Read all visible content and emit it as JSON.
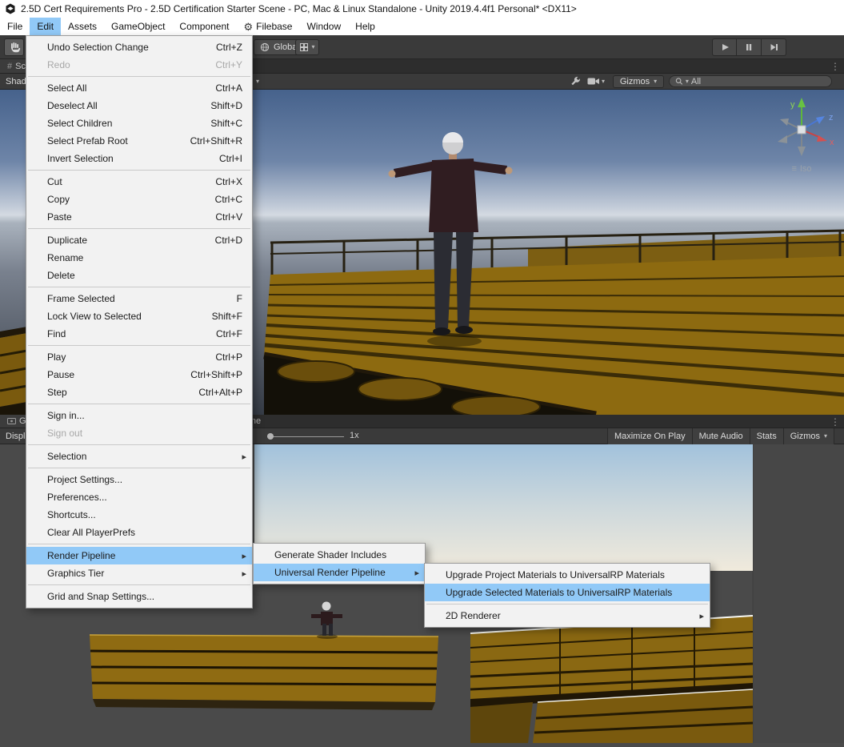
{
  "titlebar": {
    "title": "2.5D Cert Requirements Pro - 2.5D Certification Starter Scene - PC, Mac & Linux Standalone - Unity 2019.4.4f1 Personal* <DX11>"
  },
  "menubar": {
    "items": [
      {
        "label": "File"
      },
      {
        "label": "Edit",
        "selected": true
      },
      {
        "label": "Assets"
      },
      {
        "label": "GameObject"
      },
      {
        "label": "Component"
      },
      {
        "label": "Filebase",
        "icon": "gear"
      },
      {
        "label": "Window"
      },
      {
        "label": "Help"
      }
    ]
  },
  "toolbar": {
    "global_label": "Global"
  },
  "scene_panel": {
    "tab_label": "Scene",
    "shading_label": "Shaded",
    "gizmos_label": "Gizmos",
    "search_value": "All",
    "gizmo": {
      "x": "x",
      "y": "y",
      "z": "z",
      "projection": "Iso"
    }
  },
  "game_panel": {
    "tab_label": "Game",
    "timeline_tab_label": "Timeline",
    "display_label": "Display 1",
    "scale_label": "1x",
    "maximize_label": "Maximize On Play",
    "mute_label": "Mute Audio",
    "stats_label": "Stats",
    "gizmos_label": "Gizmos"
  },
  "edit_menu": {
    "items": [
      {
        "label": "Undo Selection Change",
        "shortcut": "Ctrl+Z"
      },
      {
        "label": "Redo",
        "shortcut": "Ctrl+Y",
        "disabled": true
      },
      {
        "sep": true
      },
      {
        "label": "Select All",
        "shortcut": "Ctrl+A"
      },
      {
        "label": "Deselect All",
        "shortcut": "Shift+D"
      },
      {
        "label": "Select Children",
        "shortcut": "Shift+C"
      },
      {
        "label": "Select Prefab Root",
        "shortcut": "Ctrl+Shift+R"
      },
      {
        "label": "Invert Selection",
        "shortcut": "Ctrl+I"
      },
      {
        "sep": true
      },
      {
        "label": "Cut",
        "shortcut": "Ctrl+X"
      },
      {
        "label": "Copy",
        "shortcut": "Ctrl+C"
      },
      {
        "label": "Paste",
        "shortcut": "Ctrl+V"
      },
      {
        "sep": true
      },
      {
        "label": "Duplicate",
        "shortcut": "Ctrl+D"
      },
      {
        "label": "Rename"
      },
      {
        "label": "Delete"
      },
      {
        "sep": true
      },
      {
        "label": "Frame Selected",
        "shortcut": "F"
      },
      {
        "label": "Lock View to Selected",
        "shortcut": "Shift+F"
      },
      {
        "label": "Find",
        "shortcut": "Ctrl+F"
      },
      {
        "sep": true
      },
      {
        "label": "Play",
        "shortcut": "Ctrl+P"
      },
      {
        "label": "Pause",
        "shortcut": "Ctrl+Shift+P"
      },
      {
        "label": "Step",
        "shortcut": "Ctrl+Alt+P"
      },
      {
        "sep": true
      },
      {
        "label": "Sign in..."
      },
      {
        "label": "Sign out",
        "disabled": true
      },
      {
        "sep": true
      },
      {
        "label": "Selection",
        "submenu": true
      },
      {
        "sep": true
      },
      {
        "label": "Project Settings..."
      },
      {
        "label": "Preferences..."
      },
      {
        "label": "Shortcuts..."
      },
      {
        "label": "Clear All PlayerPrefs"
      },
      {
        "sep": true
      },
      {
        "label": "Render Pipeline",
        "submenu": true,
        "highlighted": true
      },
      {
        "label": "Graphics Tier",
        "submenu": true
      },
      {
        "sep": true
      },
      {
        "label": "Grid and Snap Settings..."
      }
    ]
  },
  "render_pipeline_menu": {
    "items": [
      {
        "label": "Generate Shader Includes"
      },
      {
        "label": "Universal Render Pipeline",
        "submenu": true,
        "highlighted": true
      }
    ]
  },
  "urp_menu": {
    "items": [
      {
        "label": "Upgrade Project Materials to UniversalRP Materials"
      },
      {
        "label": "Upgrade Selected Materials to UniversalRP Materials",
        "highlighted": true
      },
      {
        "sep": true
      },
      {
        "label": "2D Renderer",
        "submenu": true
      }
    ]
  },
  "icons": {
    "caret_down": "▾",
    "submenu_arrow": "▸",
    "kebab": "⋮",
    "hash": "#",
    "iso_prefix": "≡",
    "gear": "⚙"
  },
  "colors": {
    "menu_highlight": "#91c9f7",
    "toolbar_bg": "#3a3a3a",
    "deck_gold": "#8d6a10",
    "sky_top": "#46628c"
  }
}
